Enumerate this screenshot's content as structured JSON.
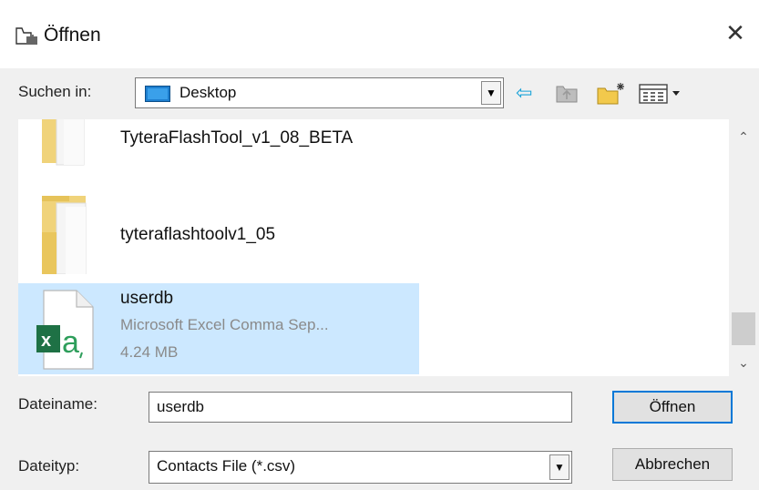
{
  "window": {
    "title": "Öffnen",
    "close_glyph": "✕",
    "title_icon": "open-folder-icon"
  },
  "lookin": {
    "label": "Suchen in:",
    "value": "Desktop",
    "value_icon": "desktop-icon",
    "arrow_glyph": "▼"
  },
  "toolbar": {
    "back_glyph": "⇦",
    "back_icon": "back-arrow-icon",
    "up_icon": "up-folder-icon",
    "new_folder_icon": "new-folder-icon",
    "view_icon": "view-menu-icon",
    "view_arrow": "▾"
  },
  "files": [
    {
      "name": "TyteraFlashTool_v1_08_BETA",
      "icon": "folder-icon",
      "selected": false
    },
    {
      "name": "tyteraflashtoolv1_05",
      "icon": "folder-icon",
      "selected": false
    },
    {
      "name": "userdb",
      "type": "Microsoft Excel Comma Sep...",
      "size": "4.24 MB",
      "icon": "excel-csv-file-icon",
      "selected": true
    }
  ],
  "scrollbar": {
    "up_glyph": "⌃",
    "down_glyph": "⌄"
  },
  "filename": {
    "label": "Dateiname:",
    "value": "userdb"
  },
  "filetype": {
    "label": "Dateityp:",
    "value": "Contacts File (*.csv)",
    "arrow_glyph": "▼"
  },
  "buttons": {
    "open": "Öffnen",
    "cancel": "Abbrechen"
  },
  "colors": {
    "selection": "#cce8ff",
    "dialog_bg": "#f0f0f0",
    "excel_green": "#1e7145"
  }
}
